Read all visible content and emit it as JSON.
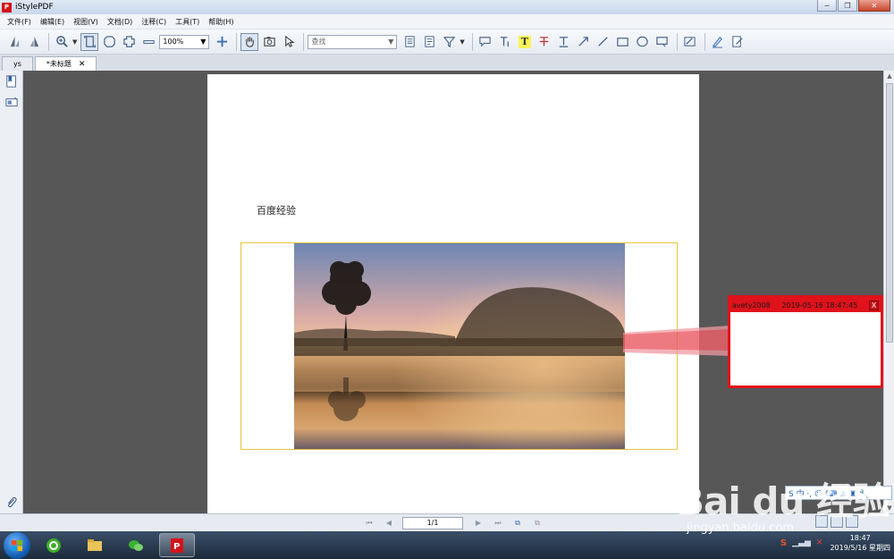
{
  "window": {
    "title": "iStylePDF",
    "logo_text": "P",
    "minimize": "─",
    "restore": "❐",
    "close": "✕"
  },
  "menu": [
    "文件(F)",
    "编辑(E)",
    "视图(V)",
    "文档(D)",
    "注释(C)",
    "工具(T)",
    "帮助(H)"
  ],
  "toolbar": {
    "zoom_value": "100%",
    "search_placeholder": "查找",
    "highlight_t": "T"
  },
  "tabs": [
    {
      "label": "ys",
      "active": false
    },
    {
      "label": "*未标题",
      "active": true,
      "close": "✕"
    }
  ],
  "page": {
    "text": "百度经验"
  },
  "comment": {
    "author": "avety2008",
    "timestamp": "2019-05-16 18:47:45",
    "close": "X",
    "color": "#e0121b"
  },
  "navigation": {
    "page_indicator": "1/1"
  },
  "taskbar": {
    "time": "18:47",
    "date": "2019/5/16 星期四"
  },
  "watermark": {
    "logo": "Bai du 经验",
    "url": "jingyan.baidu.com"
  },
  "ime": {
    "label": "S 中 ·, ☺ ⌨ ♟ ♜ 🔧"
  }
}
